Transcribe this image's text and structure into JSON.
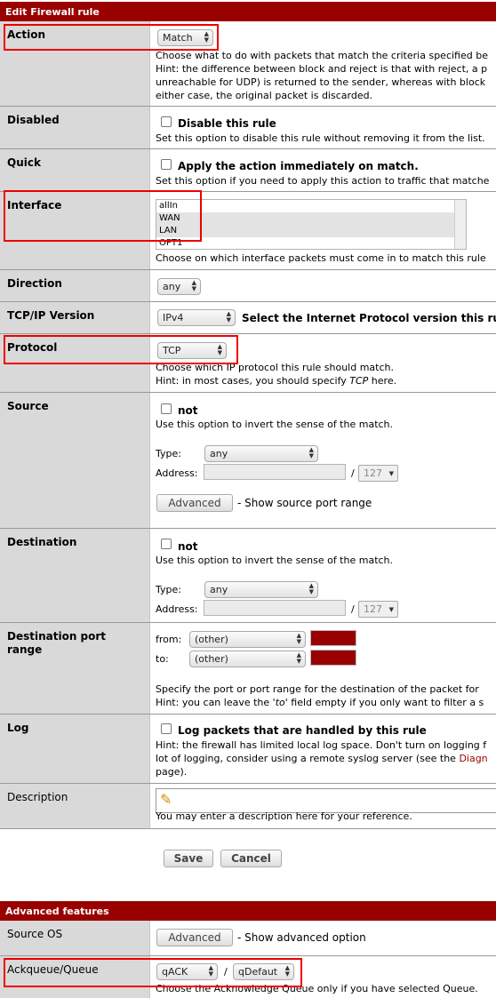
{
  "header": {
    "title": "Edit Firewall rule"
  },
  "action": {
    "label": "Action",
    "value": "Match",
    "help1": "Choose what to do with packets that match the criteria specified be",
    "help2": "Hint: the difference between block and reject is that with reject, a p",
    "help3": "unreachable for UDP) is returned to the sender, whereas with block",
    "help4": "either case, the original packet is discarded."
  },
  "disabled": {
    "label": "Disabled",
    "check_label": "Disable this rule",
    "help": "Set this option to disable this rule without removing it from the list."
  },
  "quick": {
    "label": "Quick",
    "check_label": "Apply the action immediately on match.",
    "help": "Set this option if you need to apply this action to traffic that matche"
  },
  "interface": {
    "label": "Interface",
    "options": [
      "allIn",
      "WAN",
      "LAN",
      "OPT1"
    ],
    "help": "Choose on which interface packets must come in to match this rule"
  },
  "direction": {
    "label": "Direction",
    "value": "any"
  },
  "ipversion": {
    "label": "TCP/IP Version",
    "value": "IPv4",
    "help": "Select the Internet Protocol version this rule"
  },
  "protocol": {
    "label": "Protocol",
    "value": "TCP",
    "help1": "Choose which IP protocol this rule should match.",
    "help2_pre": "Hint: in most cases, you should specify ",
    "help2_em": "TCP",
    "help2_post": "  here."
  },
  "source": {
    "label": "Source",
    "not_label": "not",
    "help": "Use this option to invert the sense of the match.",
    "type_label": "Type:",
    "type_value": "any",
    "address_label": "Address:",
    "slash": "/",
    "mask": "127",
    "advanced_button": "Advanced",
    "advanced_text": "- Show source port range"
  },
  "destination": {
    "label": "Destination",
    "not_label": "not",
    "help": "Use this option to invert the sense of the match.",
    "type_label": "Type:",
    "type_value": "any",
    "address_label": "Address:",
    "slash": "/",
    "mask": "127"
  },
  "dport": {
    "label": "Destination port range",
    "from_label": "from:",
    "from_value": "(other)",
    "to_label": "to:",
    "to_value": "(other)",
    "help1": "Specify the port or port range for the destination of the packet for",
    "help2_pre": "Hint: you can leave the ",
    "help2_em": "'to'",
    "help2_post": " field empty if you only want to filter a s"
  },
  "log": {
    "label": "Log",
    "check_label": "Log packets that are handled by this rule",
    "help1": "Hint: the firewall has limited local log space. Don't turn on logging f",
    "help2_pre": "lot of logging, consider using a remote syslog server (see the ",
    "help2_link": "Diagn",
    "help3": "page)."
  },
  "description": {
    "label": "Description",
    "help": "You may enter a description here for your reference."
  },
  "buttons": {
    "save": "Save",
    "cancel": "Cancel"
  },
  "advanced_header": {
    "title": "Advanced features"
  },
  "sourceos": {
    "label": "Source OS",
    "button": "Advanced",
    "text": "- Show advanced option"
  },
  "queue": {
    "label": "Ackqueue/Queue",
    "ack_value": "qACK",
    "slash": "/",
    "queue_value": "qDefaut",
    "help": "Choose the Acknowledge Queue only if you have selected Queue."
  },
  "colors": {
    "header": "#990000",
    "label_bg": "#d9d9d9",
    "highlight": "#ee0000"
  }
}
